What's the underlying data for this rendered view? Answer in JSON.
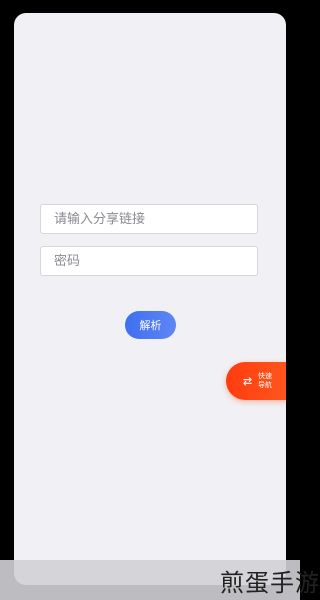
{
  "form": {
    "link_placeholder": "请输入分享链接",
    "password_placeholder": "密码",
    "parse_label": "解析"
  },
  "quick_nav": {
    "label": "快速导航",
    "icon": "swap-icon"
  },
  "watermark": {
    "text": "煎蛋手游"
  },
  "colors": {
    "background": "#f1f0f5",
    "parse_button": "#4a78f2",
    "quick_nav": "#ff4a16"
  }
}
